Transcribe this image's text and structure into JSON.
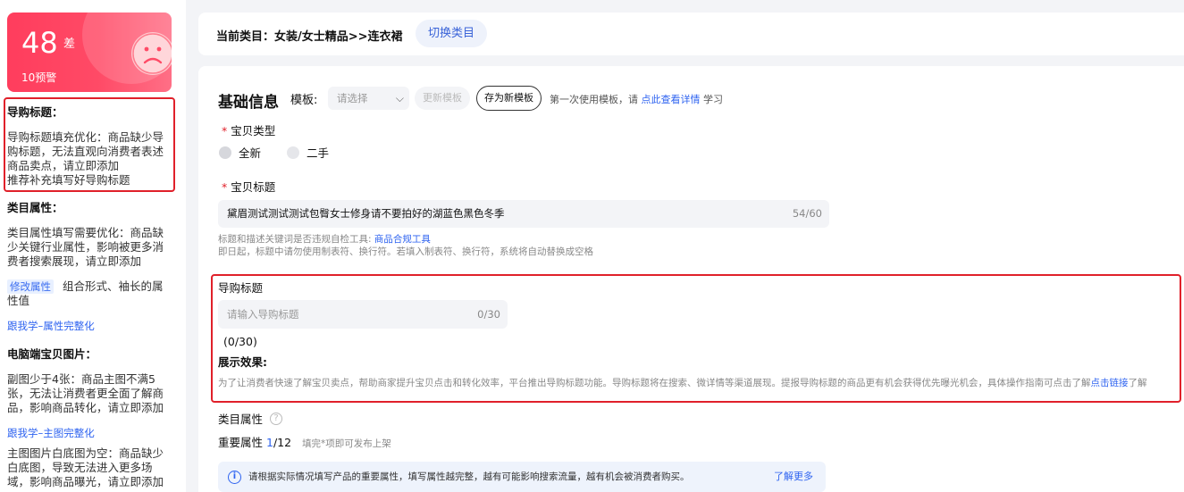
{
  "score": {
    "value": "48",
    "level": "差",
    "warnings": "10预警"
  },
  "issues": [
    {
      "title": "导购标题：",
      "body": "导购标题填充优化：商品缺少导购标题，无法直观向消费者表述商品卖点，请立即添加",
      "extra": "推荐补充填写好导购标题"
    },
    {
      "title": "类目属性：",
      "body": "类目属性填写需要优化：商品缺少关键行业属性，影响被更多消费者搜索展现，请立即添加",
      "tag": "修改属性",
      "tag_text": "组合形式、袖长的属性值",
      "link": "跟我学–属性完整化"
    },
    {
      "title": "电脑端宝贝图片：",
      "body": "副图少于4张：商品主图不满5张，无法让消费者更全面了解商品，影响商品转化，请立即添加",
      "link": "跟我学–主图完整化"
    },
    {
      "body": "主图图片白底图为空：商品缺少白底图，导致无法进入更多场域，影响商品曝光，请立即添加"
    }
  ],
  "header": {
    "current_category": "当前类目：女装/女士精品>>连衣裙",
    "switch_label": "切换类目"
  },
  "basic": {
    "title": "基础信息",
    "template_label": "模板:",
    "template_placeholder": "请选择",
    "update_template": "更新模板",
    "save_template": "存为新模板",
    "tip_prefix": "第一次使用模板，请",
    "tip_link": "点此查看详情",
    "tip_suffix": "学习"
  },
  "item_type": {
    "label": "宝贝类型",
    "options": [
      "全新",
      "二手"
    ],
    "selected": "全新"
  },
  "item_title": {
    "label": "宝贝标题",
    "value": "黛眉测试测试测试包臀女士修身请不要拍好的湖蓝色黑色冬季",
    "count": "54/60",
    "hint1_prefix": "标题和描述关键词是否违规自检工具:",
    "hint1_link": "商品合规工具",
    "hint2": "即日起，标题中请勿使用制表符、换行符。若填入制表符、换行符，系统将自动替换成空格"
  },
  "guide_title": {
    "label": "导购标题",
    "placeholder": "请输入导购标题",
    "count": "0/30",
    "count_text": "(0/30)",
    "show_label": "展示效果:",
    "desc": "为了让消费者快速了解宝贝卖点，帮助商家提升宝贝点击和转化效率，平台推出导购标题功能。导购标题将在搜索、微详情等渠道展现。提报导购标题的商品更有机会获得优先曝光机会，具体操作指南可点击了解",
    "desc_link": "点击链接",
    "desc_suffix": "了解"
  },
  "category_attr": {
    "label": "类目属性",
    "important_label": "重要属性",
    "filled": "1",
    "total": "/12",
    "hint": "填完*项即可发布上架",
    "info": "请根据实际情况填写产品的重要属性，填写属性越完整，越有可能影响搜索流量，越有机会被消费者购买。",
    "more": "了解更多"
  },
  "colors": {
    "accent": "#2e63f0",
    "danger": "#e0202a",
    "score_bg": "#ff3d5d"
  }
}
